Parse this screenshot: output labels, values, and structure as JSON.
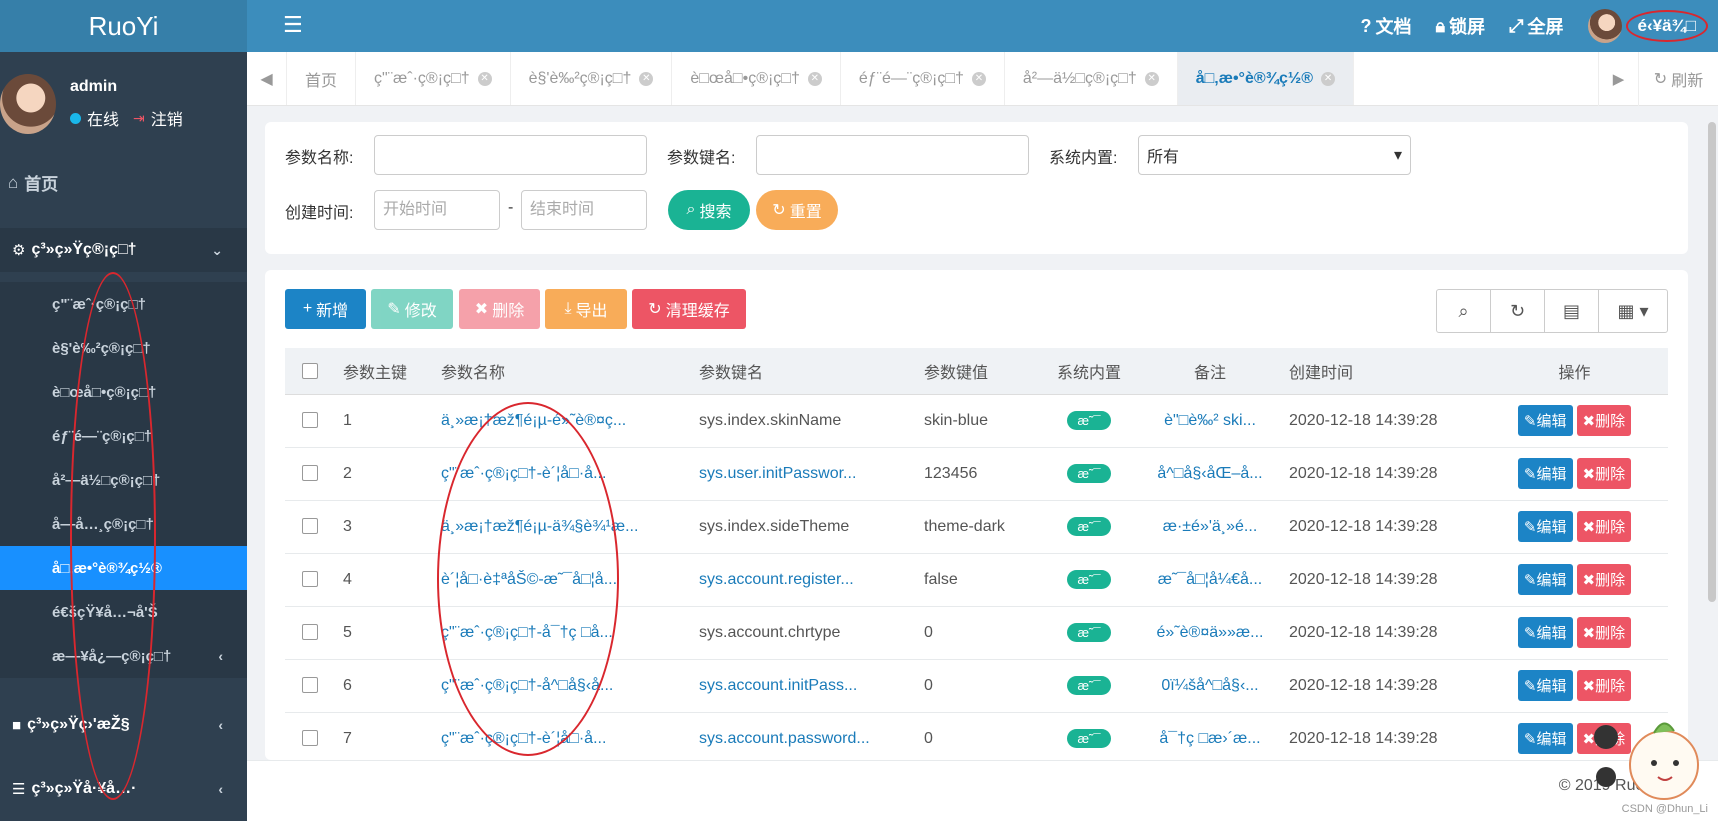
{
  "app": {
    "logo": "RuoYi"
  },
  "user": {
    "name": "admin",
    "status": "在线",
    "logout": "注销",
    "garbled_name": "é‹¥ä¾□"
  },
  "topbar": {
    "docs": "文档",
    "lock": "锁屏",
    "fullscreen": "全屏"
  },
  "tabs": [
    {
      "label": "首页"
    },
    {
      "label": "ç\"¨æˆ·ç®¡ç□†"
    },
    {
      "label": "è§'è‰²ç®¡ç□†"
    },
    {
      "label": "è□œå□•ç®¡ç□†"
    },
    {
      "label": "éƒ¨é—¨ç®¡ç□†"
    },
    {
      "label": "å²—ä½□ç®¡ç□†"
    },
    {
      "label": "å□‚æ•°è®¾ç½®"
    }
  ],
  "tab_refresh": "刷新",
  "sidebar": {
    "home": "首页",
    "system_section": "ç³»ç»Ÿç®¡ç□†",
    "sub_items": [
      "ç\"¨æˆ·ç®¡ç□†",
      "è§'è‰²ç®¡ç□†",
      "è□œå□•ç®¡ç□†",
      "éƒ¨é—¨ç®¡ç□†",
      "å²—ä½□ç®¡ç□†",
      "å—å…¸ç®¡ç□†",
      "å□‚æ•°è®¾ç½®",
      "é€šçŸ¥å…¬å'Š",
      "æ—¥å¿—ç®¡ç□†"
    ],
    "monitor_section": "ç³»ç»Ÿç›'æŽ§",
    "tools_section": "ç³»ç»Ÿå·¥å…·"
  },
  "search": {
    "param_name_label": "参数名称:",
    "param_key_label": "参数键名:",
    "builtin_label": "系统内置:",
    "builtin_value": "所有",
    "created_label": "创建时间:",
    "start_placeholder": "开始时间",
    "end_placeholder": "结束时间",
    "dash": "-",
    "search_btn": "搜索",
    "reset_btn": "重置"
  },
  "toolbar": {
    "add": "新增",
    "edit": "修改",
    "delete": "删除",
    "export": "导出",
    "clear_cache": "清理缓存"
  },
  "table": {
    "headers": [
      "参数主键",
      "参数名称",
      "参数键名",
      "参数键值",
      "系统内置",
      "备注",
      "创建时间",
      "操作"
    ],
    "edit_label": "编辑",
    "delete_label": "删除",
    "rows": [
      {
        "id": "1",
        "name": "ä¸»æ¡†æž¶é¡µ-é»˜è®¤ç...",
        "key": "sys.index.skinName",
        "key_link": false,
        "value": "skin-blue",
        "builtin": "æ˜¯",
        "remark": "è\"□è‰² ski...",
        "time": "2020-12-18 14:39:28"
      },
      {
        "id": "2",
        "name": "ç\"¨æˆ·ç®¡ç□†-è´¦å□·å...",
        "key": "sys.user.initPasswor...",
        "key_link": true,
        "value": "123456",
        "builtin": "æ˜¯",
        "remark": "å^□å§‹åŒ–å...",
        "time": "2020-12-18 14:39:28"
      },
      {
        "id": "3",
        "name": "ä¸»æ¡†æž¶é¡µ-ä¾§è¾¹æ...",
        "key": "sys.index.sideTheme",
        "key_link": false,
        "value": "theme-dark",
        "builtin": "æ˜¯",
        "remark": "æ·±é»'ä¸»é...",
        "time": "2020-12-18 14:39:28"
      },
      {
        "id": "4",
        "name": "è´¦å□·è‡ªåŠ©-æ˜¯å□¦å...",
        "key": "sys.account.register...",
        "key_link": true,
        "value": "false",
        "builtin": "æ˜¯",
        "remark": "æ˜¯å□¦å¼€å...",
        "time": "2020-12-18 14:39:28"
      },
      {
        "id": "5",
        "name": "ç\"¨æˆ·ç®¡ç□†-å¯†ç □å...",
        "key": "sys.account.chrtype",
        "key_link": false,
        "value": "0",
        "builtin": "æ˜¯",
        "remark": "é»˜è®¤ä»»æ...",
        "time": "2020-12-18 14:39:28"
      },
      {
        "id": "6",
        "name": "ç\"¨æˆ·ç®¡ç□†-å^□å§‹å...",
        "key": "sys.account.initPass...",
        "key_link": true,
        "value": "0",
        "builtin": "æ˜¯",
        "remark": "0ï¼šå^□å§‹...",
        "time": "2020-12-18 14:39:28"
      },
      {
        "id": "7",
        "name": "ç\"¨æˆ·ç®¡ç□†-è´¦å□·å...",
        "key": "sys.account.password...",
        "key_link": true,
        "value": "0",
        "builtin": "æ˜¯",
        "remark": "å¯†ç □æ›´æ...",
        "time": "2020-12-18 14:39:28"
      }
    ]
  },
  "footer": {
    "copyright": "© 2019 RuoYi",
    "watermark": "CSDN @Dhun_Li"
  }
}
